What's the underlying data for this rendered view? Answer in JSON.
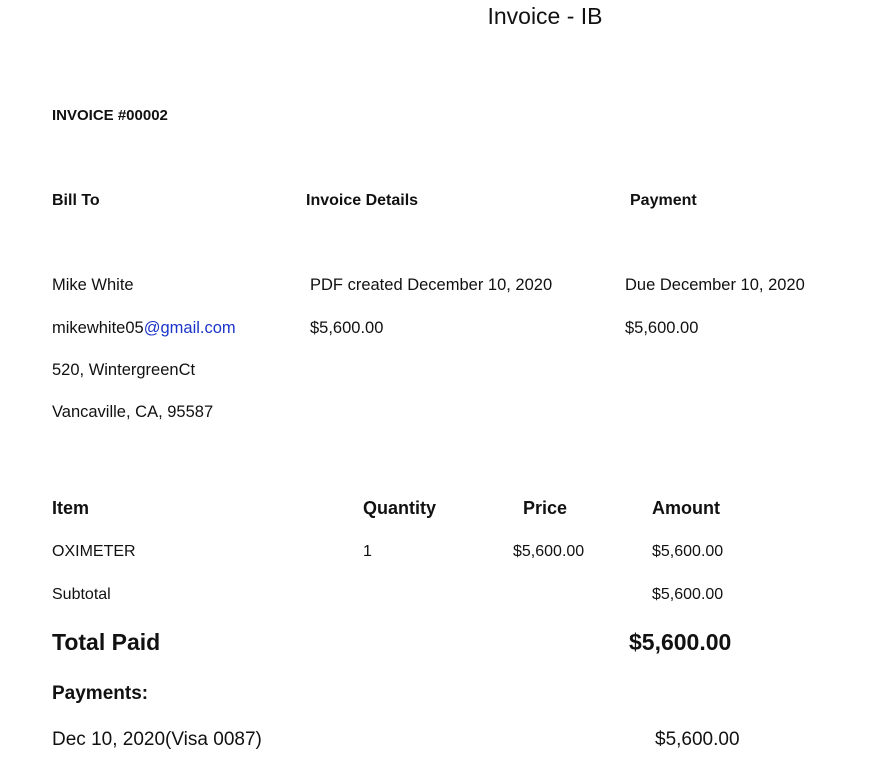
{
  "document": {
    "title": "Invoice - IB",
    "invoice_number": "INVOICE #00002"
  },
  "sections": {
    "bill_to": {
      "heading": "Bill To",
      "name": "Mike White",
      "email_local": "mikewhite05",
      "email_domain": "@gmail.com",
      "address_line1": "520, WintergreenCt",
      "address_line2": "Vancaville, CA, 95587"
    },
    "invoice_details": {
      "heading": "Invoice Details",
      "created": "PDF created December 10, 2020",
      "amount": "$5,600.00"
    },
    "payment": {
      "heading": "Payment",
      "due": "Due December 10, 2020",
      "amount": "$5,600.00"
    }
  },
  "items_table": {
    "headers": {
      "item": "Item",
      "quantity": "Quantity",
      "price": "Price",
      "amount": "Amount"
    },
    "rows": [
      {
        "item": "OXIMETER",
        "quantity": "1",
        "price": "$5,600.00",
        "amount": "$5,600.00"
      }
    ],
    "subtotal_label": "Subtotal",
    "subtotal_value": "$5,600.00"
  },
  "totals": {
    "total_paid_label": "Total Paid",
    "total_paid_value": "$5,600.00"
  },
  "payments": {
    "label": "Payments:",
    "entries": [
      {
        "description": "Dec 10, 2020(Visa 0087)",
        "amount": "$5,600.00"
      }
    ]
  }
}
